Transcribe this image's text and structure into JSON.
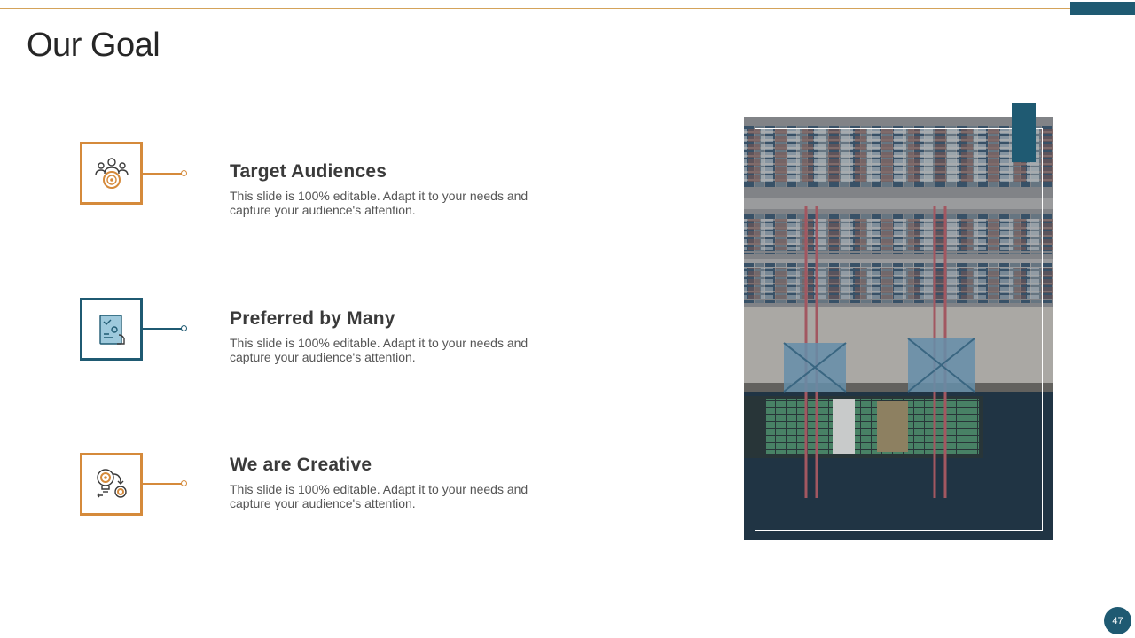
{
  "slide": {
    "title": "Our Goal",
    "page_number": "47"
  },
  "colors": {
    "accent_orange": "#d58a3b",
    "accent_blue": "#1f5a72",
    "title_text": "#262626",
    "body_text": "#555555",
    "top_rule": "#d4a35a"
  },
  "items": [
    {
      "heading": "Target Audiences",
      "body_line1": "This slide is 100% editable. Adapt it to your needs and",
      "body_line2": "capture your audience's attention.",
      "icon": "audience-target-icon",
      "accent": "orange"
    },
    {
      "heading": "Preferred by Many",
      "body_line1": "This slide is 100% editable. Adapt it to your needs and",
      "body_line2": "capture your audience's attention.",
      "icon": "goal-board-icon",
      "accent": "blue"
    },
    {
      "heading": "We are Creative",
      "body_line1": "This slide is 100% editable. Adapt it to your needs and",
      "body_line2": "capture your audience's attention.",
      "icon": "idea-bulb-target-icon",
      "accent": "orange"
    }
  ],
  "image": {
    "subject": "container-port-aerial-photo"
  }
}
